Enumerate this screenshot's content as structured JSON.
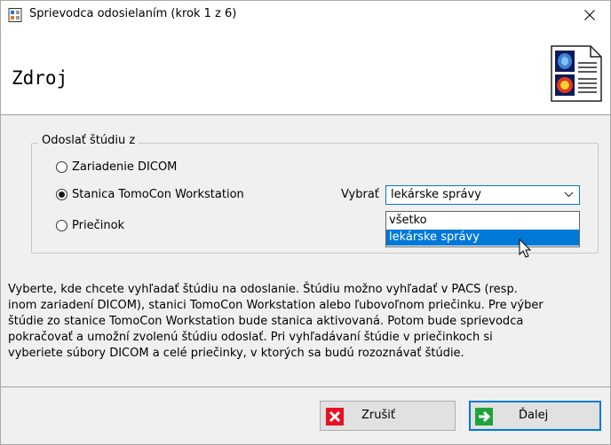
{
  "window": {
    "title": "Sprievodca odosielaním (krok 1 z 6)"
  },
  "header": {
    "title": "Zdroj"
  },
  "source_group": {
    "legend": "Odoslať štúdiu z",
    "options": [
      {
        "label": "Zariadenie DICOM",
        "checked": false
      },
      {
        "label": "Stanica TomoCon Workstation",
        "checked": true
      },
      {
        "label": "Priečinok",
        "checked": false
      }
    ],
    "select": {
      "label": "Vybrať",
      "value": "lekárske správy",
      "options": [
        "všetko",
        "lekárske správy"
      ],
      "highlighted": "lekárske správy"
    }
  },
  "description": "Vyberte, kde chcete vyhľadať štúdiu na odoslanie. Štúdiu možno vyhľadať v PACS (resp.\ninom zariadení DICOM), stanici TomoCon Workstation alebo ľubovoľnom priečinku. Pre výber\nštúdie zo stanice TomoCon Workstation bude stanica aktivovaná. Potom bude sprievodca\npokračovať a umožní zvolenú štúdiu odoslať. Pri vyhľadávaní štúdie v priečinkoch si\nvyberiete súbory DICOM a celé priečinky, v ktorých sa budú rozoznávať štúdie.",
  "buttons": {
    "cancel": {
      "label": "Zrušiť",
      "icon": "red-x-icon",
      "color": "#e81123"
    },
    "next": {
      "label": "Ďalej",
      "icon": "green-arrow-icon",
      "color": "#1fa33b"
    }
  },
  "colors": {
    "accent": "#0078d7"
  }
}
